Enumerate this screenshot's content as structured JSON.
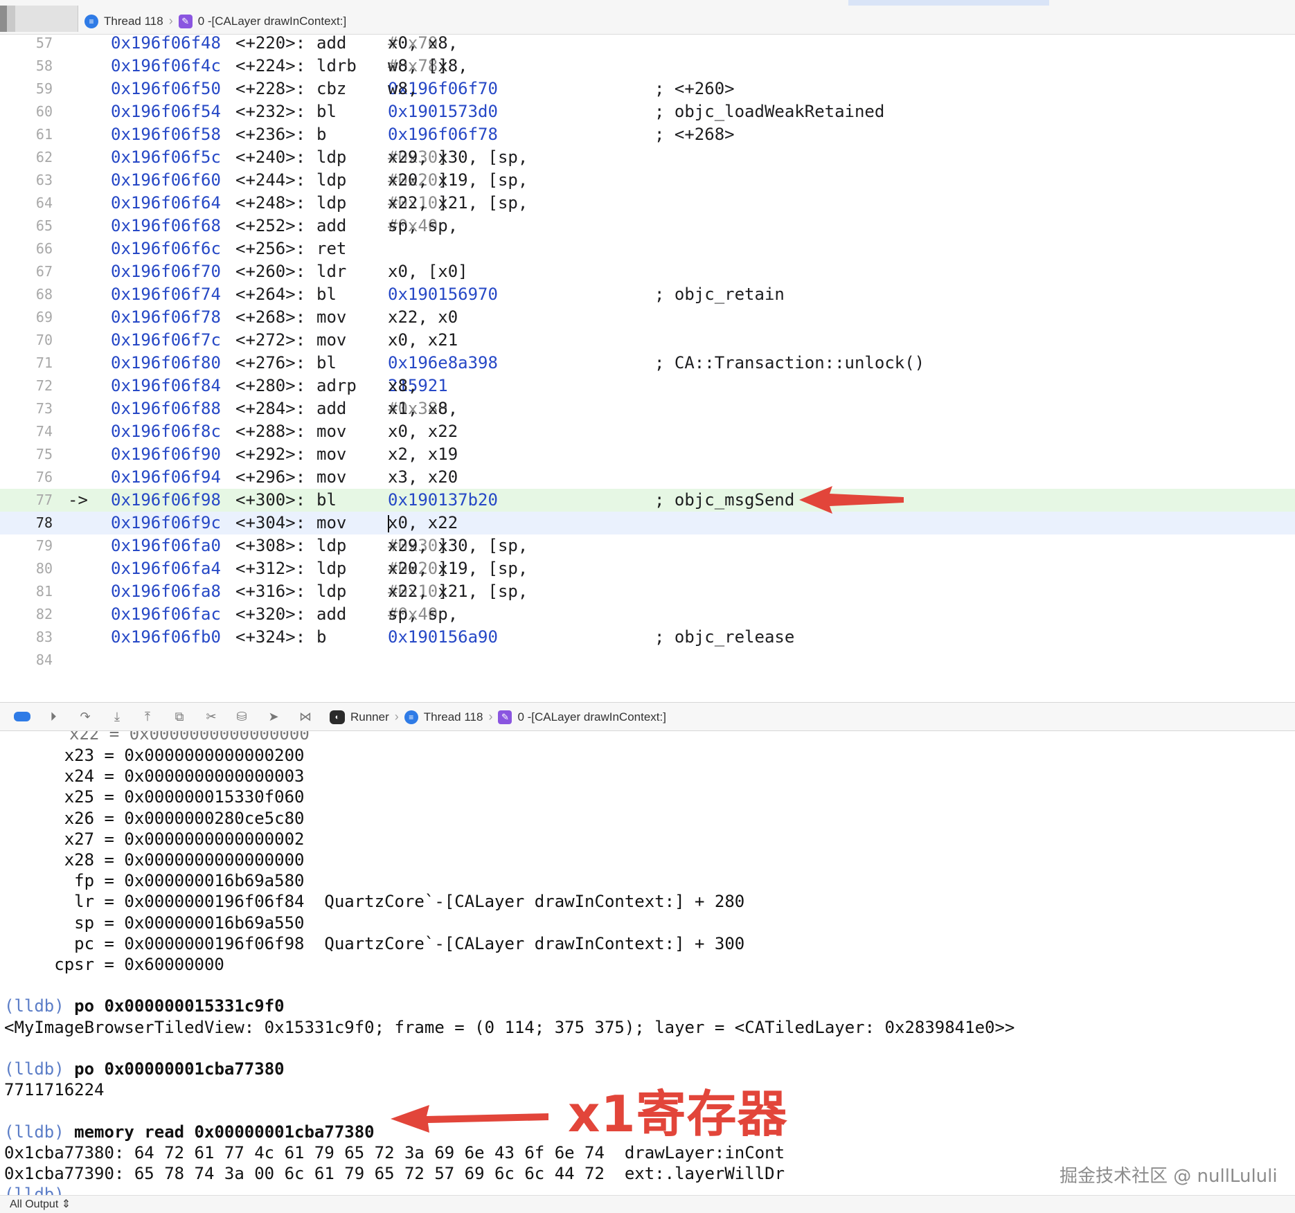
{
  "top_breadcrumb": {
    "thread": "Thread 118",
    "frame": "0 -[CALayer drawInContext:]"
  },
  "disassembly": {
    "lines": [
      {
        "ln": "57",
        "addr": "0x196f06f48",
        "off": "<+220>:",
        "mn": "add",
        "ops": [
          [
            "x0, x8, ",
            ""
          ],
          [
            "#0x70",
            "imm"
          ]
        ],
        "cmt": ""
      },
      {
        "ln": "58",
        "addr": "0x196f06f4c",
        "off": "<+224>:",
        "mn": "ldrb",
        "ops": [
          [
            "w8, [x8, ",
            ""
          ],
          [
            "#0x78",
            "imm"
          ],
          [
            "]",
            ""
          ]
        ],
        "cmt": ""
      },
      {
        "ln": "59",
        "addr": "0x196f06f50",
        "off": "<+228>:",
        "mn": "cbz",
        "ops": [
          [
            "w8, ",
            ""
          ],
          [
            "0x196f06f70",
            "num"
          ]
        ],
        "cmt": "; <+260>"
      },
      {
        "ln": "60",
        "addr": "0x196f06f54",
        "off": "<+232>:",
        "mn": "bl",
        "ops": [
          [
            "0x1901573d0",
            "num"
          ]
        ],
        "cmt": "; objc_loadWeakRetained"
      },
      {
        "ln": "61",
        "addr": "0x196f06f58",
        "off": "<+236>:",
        "mn": "b",
        "ops": [
          [
            "0x196f06f78",
            "num"
          ]
        ],
        "cmt": "; <+268>"
      },
      {
        "ln": "62",
        "addr": "0x196f06f5c",
        "off": "<+240>:",
        "mn": "ldp",
        "ops": [
          [
            "x29, x30, [sp, ",
            ""
          ],
          [
            "#0x30",
            "imm"
          ],
          [
            "]",
            ""
          ]
        ],
        "cmt": ""
      },
      {
        "ln": "63",
        "addr": "0x196f06f60",
        "off": "<+244>:",
        "mn": "ldp",
        "ops": [
          [
            "x20, x19, [sp, ",
            ""
          ],
          [
            "#0x20",
            "imm"
          ],
          [
            "]",
            ""
          ]
        ],
        "cmt": ""
      },
      {
        "ln": "64",
        "addr": "0x196f06f64",
        "off": "<+248>:",
        "mn": "ldp",
        "ops": [
          [
            "x22, x21, [sp, ",
            ""
          ],
          [
            "#0x10",
            "imm"
          ],
          [
            "]",
            ""
          ]
        ],
        "cmt": ""
      },
      {
        "ln": "65",
        "addr": "0x196f06f68",
        "off": "<+252>:",
        "mn": "add",
        "ops": [
          [
            "sp, sp, ",
            ""
          ],
          [
            "#0x40",
            "imm"
          ]
        ],
        "cmt": ""
      },
      {
        "ln": "66",
        "addr": "0x196f06f6c",
        "off": "<+256>:",
        "mn": "ret",
        "ops": [],
        "cmt": ""
      },
      {
        "ln": "67",
        "addr": "0x196f06f70",
        "off": "<+260>:",
        "mn": "ldr",
        "ops": [
          [
            "x0, [x0]",
            ""
          ]
        ],
        "cmt": ""
      },
      {
        "ln": "68",
        "addr": "0x196f06f74",
        "off": "<+264>:",
        "mn": "bl",
        "ops": [
          [
            "0x190156970",
            "num"
          ]
        ],
        "cmt": "; objc_retain"
      },
      {
        "ln": "69",
        "addr": "0x196f06f78",
        "off": "<+268>:",
        "mn": "mov",
        "ops": [
          [
            "x22, x0",
            ""
          ]
        ],
        "cmt": ""
      },
      {
        "ln": "70",
        "addr": "0x196f06f7c",
        "off": "<+272>:",
        "mn": "mov",
        "ops": [
          [
            "x0, x21",
            ""
          ]
        ],
        "cmt": ""
      },
      {
        "ln": "71",
        "addr": "0x196f06f80",
        "off": "<+276>:",
        "mn": "bl",
        "ops": [
          [
            "0x196e8a398",
            "num"
          ]
        ],
        "cmt": "; CA::Transaction::unlock()"
      },
      {
        "ln": "72",
        "addr": "0x196f06f84",
        "off": "<+280>:",
        "mn": "adrp",
        "ops": [
          [
            "x8, ",
            ""
          ],
          [
            "215921",
            "num"
          ]
        ],
        "cmt": ""
      },
      {
        "ln": "73",
        "addr": "0x196f06f88",
        "off": "<+284>:",
        "mn": "add",
        "ops": [
          [
            "x1, x8, ",
            ""
          ],
          [
            "#0x380",
            "imm"
          ]
        ],
        "cmt": ""
      },
      {
        "ln": "74",
        "addr": "0x196f06f8c",
        "off": "<+288>:",
        "mn": "mov",
        "ops": [
          [
            "x0, x22",
            ""
          ]
        ],
        "cmt": ""
      },
      {
        "ln": "75",
        "addr": "0x196f06f90",
        "off": "<+292>:",
        "mn": "mov",
        "ops": [
          [
            "x2, x19",
            ""
          ]
        ],
        "cmt": ""
      },
      {
        "ln": "76",
        "addr": "0x196f06f94",
        "off": "<+296>:",
        "mn": "mov",
        "ops": [
          [
            "x3, x20",
            ""
          ]
        ],
        "cmt": ""
      },
      {
        "ln": "77",
        "addr": "0x196f06f98",
        "off": "<+300>:",
        "mn": "bl",
        "ops": [
          [
            "0x190137b20",
            "num"
          ]
        ],
        "cmt": "; objc_msgSend",
        "pc": "->"
      },
      {
        "ln": "78",
        "addr": "0x196f06f9c",
        "off": "<+304>:",
        "mn": "mov",
        "ops": [
          [
            "x0, x22",
            ""
          ]
        ],
        "cmt": "",
        "cursor": true
      },
      {
        "ln": "79",
        "addr": "0x196f06fa0",
        "off": "<+308>:",
        "mn": "ldp",
        "ops": [
          [
            "x29, x30, [sp, ",
            ""
          ],
          [
            "#0x30",
            "imm"
          ],
          [
            "]",
            ""
          ]
        ],
        "cmt": ""
      },
      {
        "ln": "80",
        "addr": "0x196f06fa4",
        "off": "<+312>:",
        "mn": "ldp",
        "ops": [
          [
            "x20, x19, [sp, ",
            ""
          ],
          [
            "#0x20",
            "imm"
          ],
          [
            "]",
            ""
          ]
        ],
        "cmt": ""
      },
      {
        "ln": "81",
        "addr": "0x196f06fa8",
        "off": "<+316>:",
        "mn": "ldp",
        "ops": [
          [
            "x22, x21, [sp, ",
            ""
          ],
          [
            "#0x10",
            "imm"
          ],
          [
            "]",
            ""
          ]
        ],
        "cmt": ""
      },
      {
        "ln": "82",
        "addr": "0x196f06fac",
        "off": "<+320>:",
        "mn": "add",
        "ops": [
          [
            "sp, sp, ",
            ""
          ],
          [
            "#0x40",
            "imm"
          ]
        ],
        "cmt": ""
      },
      {
        "ln": "83",
        "addr": "0x196f06fb0",
        "off": "<+324>:",
        "mn": "b",
        "ops": [
          [
            "0x190156a90",
            "num"
          ]
        ],
        "cmt": "; objc_release"
      },
      {
        "ln": "84",
        "addr": "",
        "off": "",
        "mn": "",
        "ops": [],
        "cmt": ""
      }
    ]
  },
  "debug_bar": {
    "process": "Runner",
    "thread": "Thread 118",
    "frame": "0 -[CALayer drawInContext:]"
  },
  "console": {
    "lines": [
      {
        "text": "      x23 = 0x0000000000000200"
      },
      {
        "text": "      x24 = 0x0000000000000003"
      },
      {
        "text": "      x25 = 0x000000015330f060"
      },
      {
        "text": "      x26 = 0x0000000280ce5c80"
      },
      {
        "text": "      x27 = 0x0000000000000002"
      },
      {
        "text": "      x28 = 0x0000000000000000"
      },
      {
        "text": "       fp = 0x000000016b69a580"
      },
      {
        "text": "       lr = 0x0000000196f06f84  QuartzCore`-[CALayer drawInContext:] + 280"
      },
      {
        "text": "       sp = 0x000000016b69a550"
      },
      {
        "text": "       pc = 0x0000000196f06f98  QuartzCore`-[CALayer drawInContext:] + 300"
      },
      {
        "text": "     cpsr = 0x60000000"
      },
      {
        "text": ""
      },
      {
        "prompt": "(lldb)",
        "cmd": " po 0x000000015331c9f0"
      },
      {
        "text": "<MyImageBrowserTiledView: 0x15331c9f0; frame = (0 114; 375 375); layer = <CATiledLayer: 0x2839841e0>>"
      },
      {
        "text": ""
      },
      {
        "prompt": "(lldb)",
        "cmd": " po 0x00000001cba77380"
      },
      {
        "text": "7711716224"
      },
      {
        "text": ""
      },
      {
        "prompt": "(lldb)",
        "cmd": " memory read 0x00000001cba77380"
      },
      {
        "text": "0x1cba77380: 64 72 61 77 4c 61 79 65 72 3a 69 6e 43 6f 6e 74  drawLayer:inCont"
      },
      {
        "text": "0x1cba77390: 65 78 74 3a 00 6c 61 79 65 72 57 69 6c 6c 44 72  ext:.layerWillDr"
      },
      {
        "prompt": "(lldb)",
        "cmd": ""
      }
    ]
  },
  "annotation": {
    "register_note": "x1寄存器",
    "arrow_color": "#e2453a"
  },
  "watermark": "掘金技术社区 @ nullLululi",
  "bottom_bar": {
    "filter": "All Output ⇕"
  },
  "colors": {
    "pc_line_bg": "#e6f7e4",
    "cursor_line_bg": "#eaf1fd",
    "address_blue": "#2648c6",
    "prompt_blue": "#5b7dc7"
  }
}
